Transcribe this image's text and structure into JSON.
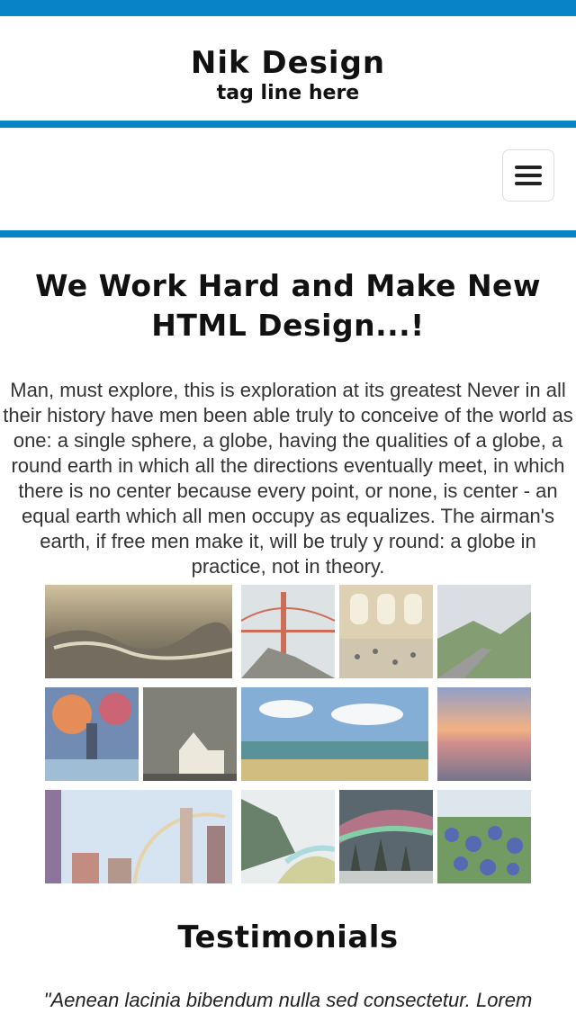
{
  "header": {
    "site_title": "Nik Design",
    "tagline": "tag line here"
  },
  "nav": {
    "menu_icon": "hamburger-icon"
  },
  "main": {
    "headline_line1": "We Work Hard and Make New",
    "headline_line2": "HTML Design...!",
    "intro": "Man, must explore, this is exploration at its greatest Never in all their history have men been able truly to conceive of the world as one: a single sphere, a globe, having the qualities of a globe, a round earth in which all the directions eventually meet, in which there is no center because every point, or none, is center - an equal earth which all men occupy as equalizes. The airman's earth, if free men make it, will be truly y round: a globe in practice, not in theory."
  },
  "gallery": {
    "images": [
      "stormy-sea-painting",
      "golden-gate-bridge-fog",
      "grand-central-terminal",
      "mountain-road",
      "rainy-street-painting",
      "church-at-dusk",
      "sea-under-clouds",
      "sunset-over-water",
      "city-skyline-rainbow",
      "coastal-beach",
      "aurora-over-forest",
      "bluebonnet-flowers"
    ]
  },
  "testimonials": {
    "title": "Testimonials",
    "quote": "\"Aenean lacinia bibendum nulla sed consectetur. Lorem"
  },
  "colors": {
    "accent": "#0784c8"
  }
}
